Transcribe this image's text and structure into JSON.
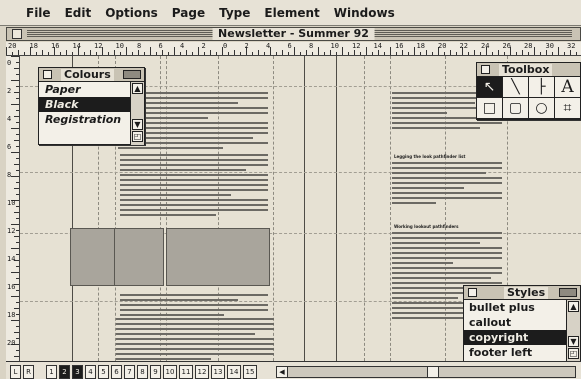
{
  "menubar": {
    "apple_glyph": "",
    "items": [
      "File",
      "Edit",
      "Options",
      "Page",
      "Type",
      "Element",
      "Windows"
    ]
  },
  "window": {
    "title": "Newsletter - Summer 92"
  },
  "ruler": {
    "top_numbers": [
      "20",
      "18",
      "16",
      "14",
      "12",
      "10",
      "8",
      "6",
      "4",
      "2",
      "0",
      "2",
      "4",
      "6",
      "8",
      "10",
      "12",
      "14",
      "16",
      "18",
      "20",
      "22",
      "24",
      "26",
      "28",
      "30",
      "32"
    ],
    "left_numbers": [
      "0",
      "2",
      "4",
      "6",
      "8",
      "10",
      "12",
      "14",
      "16",
      "18",
      "20"
    ]
  },
  "colours_palette": {
    "title": "Colours",
    "items": [
      "Paper",
      "Black",
      "Registration"
    ],
    "selected": "Black"
  },
  "toolbox_palette": {
    "title": "Toolbox",
    "tools": [
      {
        "icon": "pointer-icon",
        "glyph": "↖"
      },
      {
        "icon": "diagonal-line-icon",
        "glyph": "╲"
      },
      {
        "icon": "perpendicular-line-icon",
        "glyph": "├"
      },
      {
        "icon": "text-tool-icon",
        "glyph": "A"
      },
      {
        "icon": "rectangle-icon",
        "glyph": "□"
      },
      {
        "icon": "rounded-rectangle-icon",
        "glyph": "▢"
      },
      {
        "icon": "ellipse-icon",
        "glyph": "○"
      },
      {
        "icon": "crop-icon",
        "glyph": "⌗"
      }
    ],
    "selected_tool": "pointer-icon"
  },
  "document": {
    "heading_1": "Legging the look pathfinder list",
    "heading_2": "Working lookout pathfinders"
  },
  "styles_palette": {
    "title": "Styles",
    "items": [
      "bullet plus",
      "callout",
      "copyright",
      "footer left"
    ],
    "selected": "copyright"
  },
  "pagebar": {
    "master_pages": [
      "L",
      "R"
    ],
    "pages": [
      "1",
      "2",
      "3",
      "4",
      "5",
      "6",
      "7",
      "8",
      "9",
      "10",
      "11",
      "12",
      "13",
      "14",
      "15"
    ],
    "active_pages": [
      "2",
      "3"
    ]
  }
}
